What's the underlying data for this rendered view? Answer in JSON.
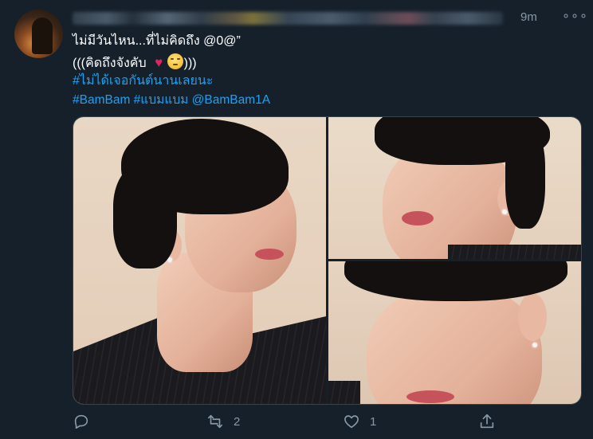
{
  "tweet": {
    "time": "9m",
    "more_label": "∘∘∘",
    "text_line1": "ไม่มีวันไหน...ที่ไม่คิดถึง @0@”",
    "text_line2_prefix": "(((คิดถึงจังคับ",
    "text_line2_suffix": ")))",
    "heart": "♥",
    "hashtag_line": "#ไม่ได้เจอกันต์นานเลยนะ",
    "tags_line": "#BamBam #แบมแบม @BamBam1A"
  },
  "actions": {
    "reply_count": "",
    "retweet_count": "2",
    "like_count": "1",
    "share_count": ""
  },
  "colors": {
    "background": "#15202b",
    "text": "#ffffff",
    "muted": "#8899a6",
    "link": "#1da1f2",
    "heart": "#e0245e"
  },
  "icons": [
    "avatar",
    "more-icon",
    "heart-emoji",
    "face-emoji",
    "reply-icon",
    "retweet-icon",
    "like-icon",
    "share-icon"
  ]
}
